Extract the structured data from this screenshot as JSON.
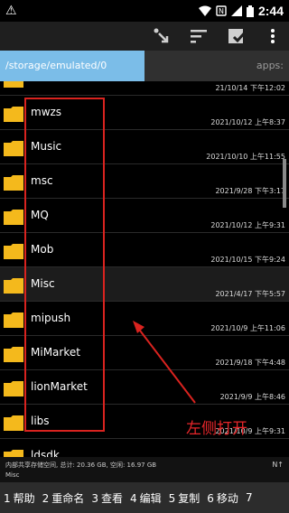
{
  "status_bar": {
    "warning_icon": "warning-triangle-icon",
    "time": "2:44"
  },
  "toolbar": {
    "icons": [
      "move-down-icon",
      "sort-icon",
      "select-all-icon",
      "more-vert-icon"
    ]
  },
  "path_bar": {
    "current_path": "/storage/emulated/0",
    "right_tab": "apps:"
  },
  "files": [
    {
      "name": "",
      "date": "21/10/14 下午12:02"
    },
    {
      "name": "mwzs",
      "date": "2021/10/12 上午8:37"
    },
    {
      "name": "Music",
      "date": "2021/10/10 上午11:55"
    },
    {
      "name": "msc",
      "date": "2021/9/28 下午3:17"
    },
    {
      "name": "MQ",
      "date": "2021/10/12 上午9:31"
    },
    {
      "name": "Mob",
      "date": "2021/10/15 下午9:24"
    },
    {
      "name": "Misc",
      "date": "2021/4/17 下午5:57"
    },
    {
      "name": "mipush",
      "date": "2021/10/9 上午11:06"
    },
    {
      "name": "MiMarket",
      "date": "2021/9/18 下午4:48"
    },
    {
      "name": "lionMarket",
      "date": "2021/9/9 上午8:46"
    },
    {
      "name": "libs",
      "date": "2021/10/9 上午9:31"
    },
    {
      "name": "ldsdk",
      "date": ""
    }
  ],
  "annotation": {
    "text": "左侧打开",
    "color": "#e8262a"
  },
  "storage_info": {
    "line1": "内部共享存储空间, 总计: 20.36 GB, 空闲: 16.97 GB",
    "line2": "Misc",
    "flag": "N↑"
  },
  "bottom_bar": [
    {
      "num": "1",
      "label": "帮助"
    },
    {
      "num": "2",
      "label": "重命名"
    },
    {
      "num": "3",
      "label": "查看"
    },
    {
      "num": "4",
      "label": "编辑"
    },
    {
      "num": "5",
      "label": "复制"
    },
    {
      "num": "6",
      "label": "移动"
    },
    {
      "num": "7",
      "label": ""
    }
  ],
  "colors": {
    "folder": "#f4b91c",
    "path_active": "#7bbde8",
    "annotation_red": "#d9231f"
  }
}
